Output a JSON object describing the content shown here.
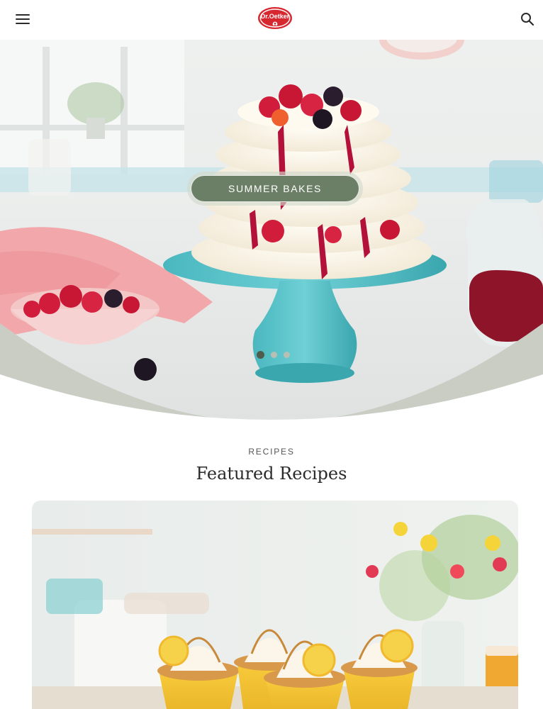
{
  "header": {
    "menu_icon": "hamburger-menu-icon",
    "logo_text": "Dr.Oetker",
    "search_icon": "search-icon"
  },
  "hero": {
    "cta_label": "SUMMER BAKES",
    "slides_total": 3,
    "active_slide": 1
  },
  "section": {
    "eyebrow": "RECIPES",
    "title": "Featured Recipes"
  },
  "colors": {
    "accent_green": "#6b7f66",
    "curve_sage": "#c9cdc3",
    "dot_active": "#4f5c4c",
    "brand_red": "#d7282f"
  }
}
